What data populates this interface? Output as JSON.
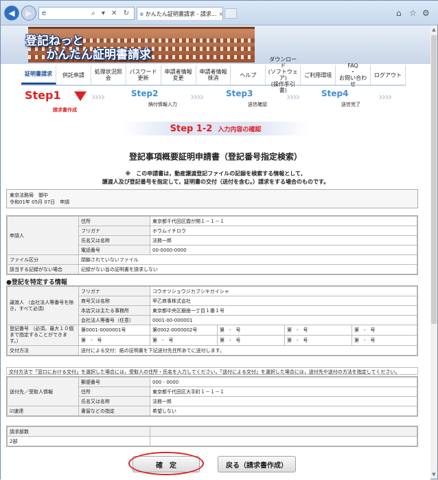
{
  "browser": {
    "address_glyph": "e",
    "address_tools": "⌕ ▾ ✕ ↻",
    "tab_title": "かんたん証明書請求 - 請求...",
    "tab_close": "×",
    "home_icon": "⌂",
    "star_icon": "☆",
    "gear_icon": "⚙"
  },
  "banner": {
    "line1": "登記ねっと",
    "line2": "かんたん証明書請求"
  },
  "nav": [
    {
      "label": "証明書請求",
      "active": true
    },
    {
      "label": "供託申請"
    },
    {
      "label": "処理状況照会"
    },
    {
      "label": "パスワード\n更新"
    },
    {
      "label": "申請者情報\n変更"
    },
    {
      "label": "申請者情報\n抹消"
    },
    {
      "label": "ヘルプ"
    },
    {
      "label": "ダウンロード\n(ソフトウェア)\n(操作手引書)"
    },
    {
      "label": "ご利用環境"
    },
    {
      "label": "FAQ\n・\nお問い合わせ"
    },
    {
      "label": "ログアウト"
    }
  ],
  "steps": {
    "s1": "Step1",
    "s1_sub": "請求書作成",
    "s2": "Step2",
    "s2_sub": "納付情報入力",
    "s3": "Step3",
    "s3_sub": "送信確認",
    "s4": "Step4",
    "s4_sub": "送信完了"
  },
  "subheader": {
    "big": "Step 1-2",
    "small": "入力内容の確認"
  },
  "page_title": "登記事項概要証明申請書（登記番号指定検索）",
  "note_line1": "※　この申請書は，動産譲渡登記ファイルの記録を検索する情報として，",
  "note_line2": "譲渡人及び登記番号を指定して，証明書の交付（送付を含む。）請求をする場合のものです。",
  "office": {
    "line1": "東京法務局　御中",
    "line2": "令和01年 05月 07日　申請"
  },
  "applicant": {
    "label": "申請人",
    "rows": [
      [
        "住所",
        "東京都千代田区霞が関１－１－１"
      ],
      [
        "フリガナ",
        "ホウムイチロウ"
      ],
      [
        "氏名又は名称",
        "法務一郎"
      ],
      [
        "電話番号",
        "00-0000-0000"
      ]
    ],
    "file_label": "ファイル区分",
    "file_value": "閉鎖されていないファイル",
    "norecord_label": "該当する記録がない場合",
    "norecord_value": "記録がない旨の証明書を請求しない"
  },
  "section_title": "●登記を特定する情報",
  "transferor": {
    "label": "譲渡人\n（会社法人等番号を除き，すべて必須）",
    "rows": [
      [
        "フリガナ",
        "コウオツショウジカブシキガイシャ"
      ],
      [
        "商号又は名称",
        "甲乙商事株式会社"
      ],
      [
        "本店又は主たる事務所",
        "東京都中央区銀座一丁目１番１号"
      ],
      [
        "会社法人等番号（任意）",
        "0001-00-000001"
      ]
    ]
  },
  "regnum": {
    "label": "登記番号\n（必須。最大１０個まで指定することができます。）",
    "row1": [
      "第0001-0000001号",
      "第0002-0000002号",
      "第　-　号",
      "第　-　号",
      "第　-　号"
    ],
    "row2": [
      "第　-　号",
      "第　-　号",
      "第　-　号",
      "第　-　号",
      "第　-　号"
    ]
  },
  "delivery": {
    "label": "交付方法",
    "value": "送付による交付：紙の証明書を下記送付先住所あてに送付します。"
  },
  "delivery_note": "交付方法で「窓口における交付」を選択した場合には，受取人の住所・氏名を入力してください。「送付による交付」を選択した場合には，送付先や送付の方法を指定してください。",
  "recipient": {
    "label": "送付先／受取人情報",
    "rows": [
      [
        "郵便番号",
        "000 - 0000"
      ],
      [
        "住所",
        "東京都千代田区大手町１－１－１"
      ],
      [
        "氏名又は名称",
        "法務一郎"
      ]
    ],
    "express_label": "☑速達",
    "special_label": "書留などの指定",
    "special_value": "希望しない"
  },
  "count": {
    "label": "請求部数",
    "value": "2部"
  },
  "buttons": {
    "confirm": "確　定",
    "back": "戻る（請求書作成）"
  }
}
